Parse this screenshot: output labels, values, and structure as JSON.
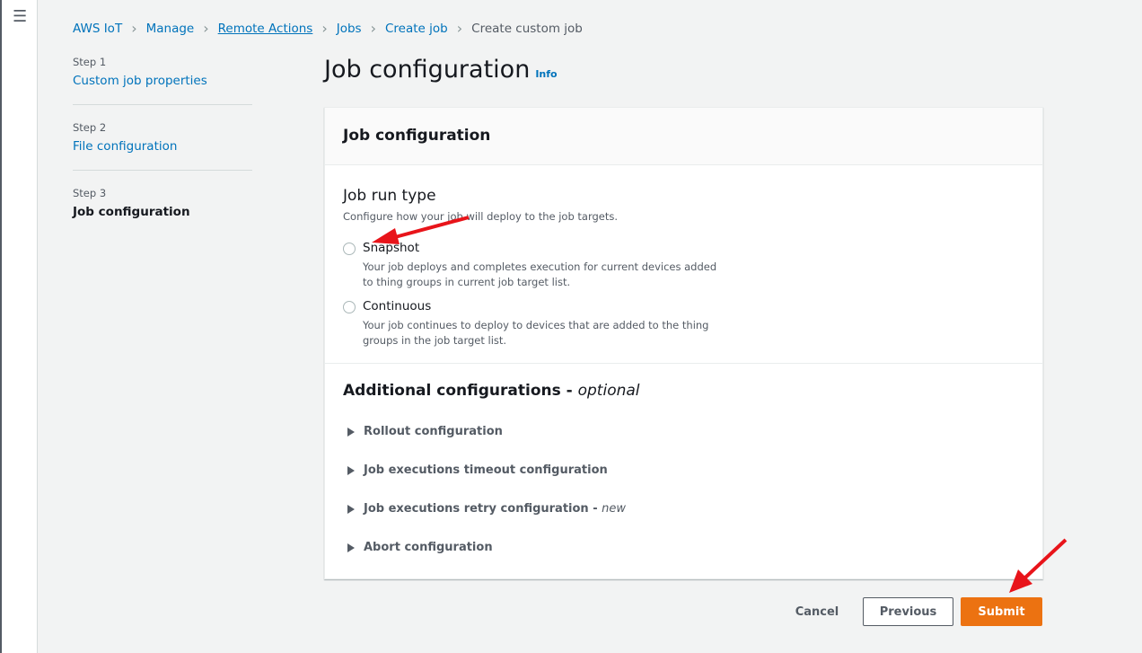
{
  "breadcrumbs": [
    "AWS IoT",
    "Manage",
    "Remote Actions",
    "Jobs",
    "Create job",
    "Create custom job"
  ],
  "steps": [
    {
      "num": "Step 1",
      "label": "Custom job properties"
    },
    {
      "num": "Step 2",
      "label": "File configuration"
    },
    {
      "num": "Step 3",
      "label": "Job configuration"
    }
  ],
  "page": {
    "title": "Job configuration",
    "info": "Info"
  },
  "panel": {
    "header": "Job configuration",
    "run_type": {
      "title": "Job run type",
      "desc": "Configure how your job will deploy to the job targets.",
      "options": [
        {
          "label": "Snapshot",
          "desc": "Your job deploys and completes execution for current devices added to thing groups in current job target list."
        },
        {
          "label": "Continuous",
          "desc": "Your job continues to deploy to devices that are added to the thing groups in the job target list."
        }
      ]
    },
    "additional": {
      "title": "Additional configurations - ",
      "optional": "optional",
      "items": [
        {
          "label": "Rollout configuration"
        },
        {
          "label": "Job executions timeout configuration"
        },
        {
          "label": "Job executions retry configuration - ",
          "tag": "new"
        },
        {
          "label": "Abort configuration"
        }
      ]
    }
  },
  "buttons": {
    "cancel": "Cancel",
    "previous": "Previous",
    "submit": "Submit"
  },
  "colors": {
    "accent": "#ec7211",
    "link": "#0073bb",
    "annotation": "#e8141a"
  }
}
